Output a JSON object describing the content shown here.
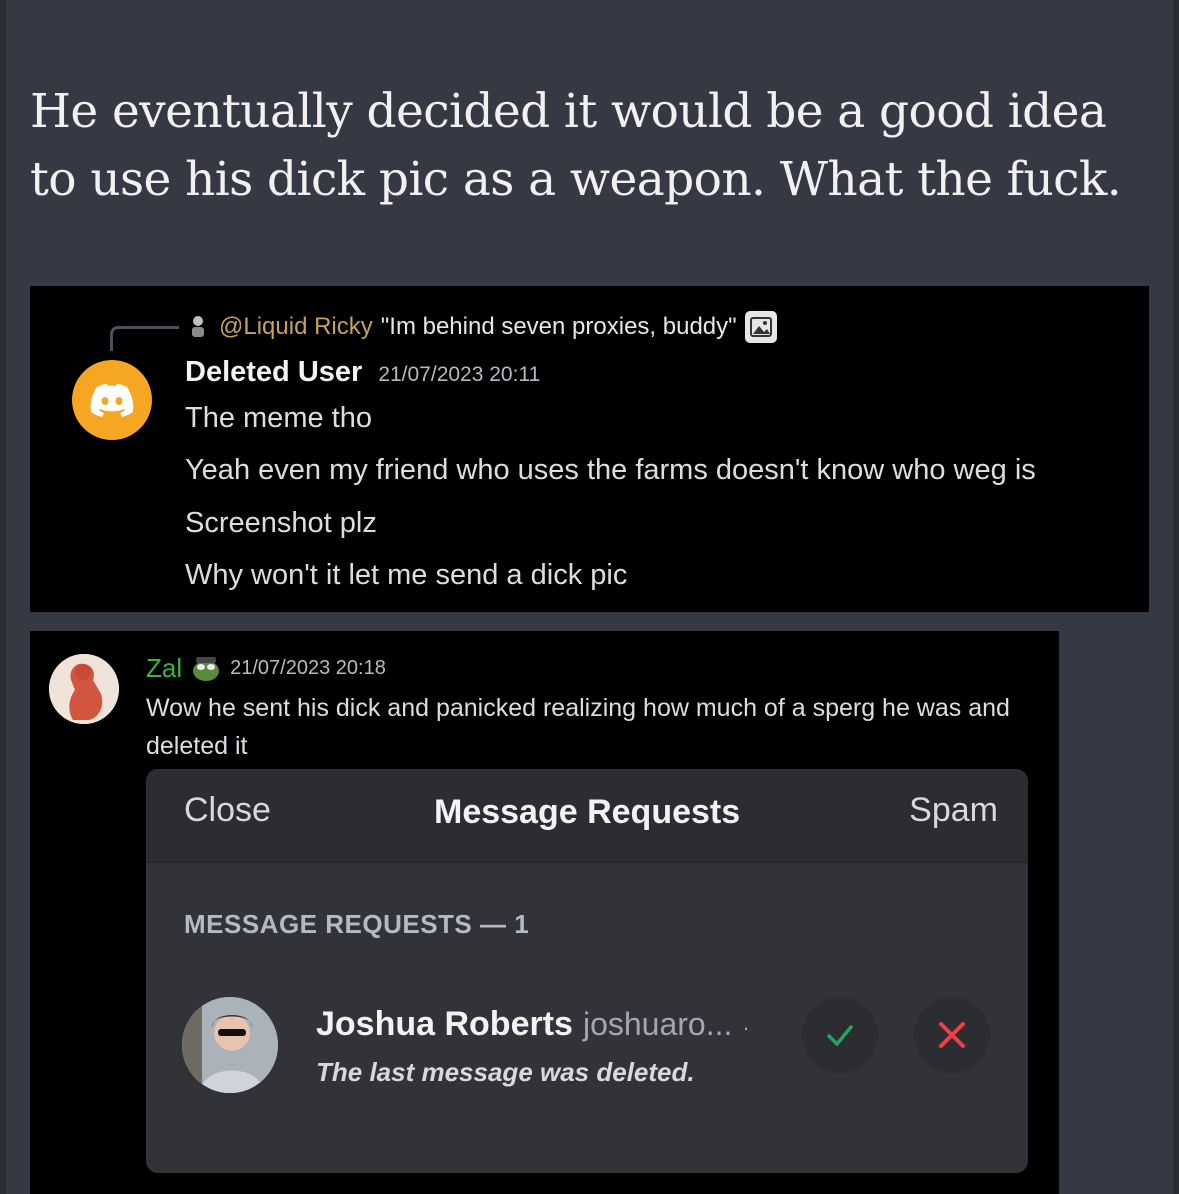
{
  "post": {
    "text": "He eventually decided it would be a good idea to use his dick pic as a weapon. What the fuck."
  },
  "discord_message_1": {
    "reply": {
      "mention": "@Liquid Ricky",
      "quote": "\"Im behind seven proxies, buddy\"",
      "icon": "image-icon"
    },
    "author": "Deleted User",
    "timestamp": "21/07/2023 20:11",
    "lines": [
      "The meme tho",
      "Yeah even my friend who uses the farms doesn't know who weg is",
      "Screenshot plz",
      "Why won't it let me send a dick pic"
    ],
    "avatar_color": "#f5a623"
  },
  "discord_message_2": {
    "author": "Zal",
    "author_color": "#3fb33f",
    "timestamp": "21/07/2023 20:18",
    "text": "Wow he sent his dick and panicked realizing how much of a sperg he was and deleted it",
    "embedded_screenshot": {
      "header": {
        "close": "Close",
        "title": "Message Requests",
        "spam": "Spam"
      },
      "section_label": "MESSAGE REQUESTS — 1",
      "request": {
        "name": "Joshua Roberts",
        "handle": "joshuaro...",
        "separator": "·",
        "subtitle": "The last message was deleted.",
        "accept_icon": "check-icon",
        "decline_icon": "x-icon",
        "accept_color": "#23a55a",
        "decline_color": "#f23f43"
      }
    }
  }
}
